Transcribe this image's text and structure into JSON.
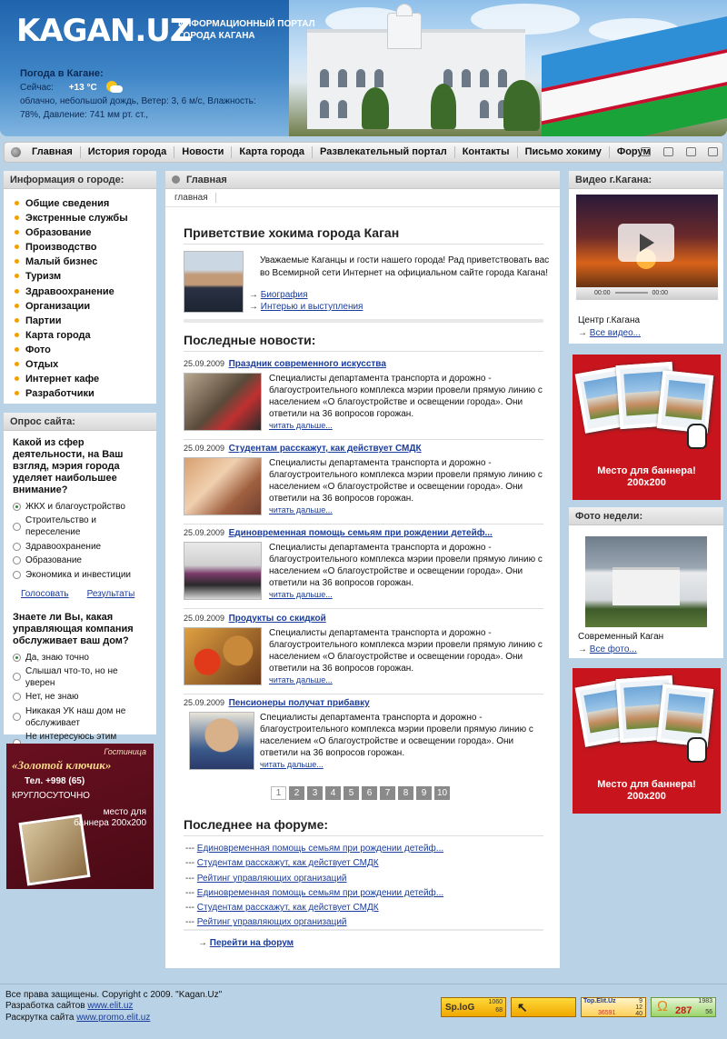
{
  "header": {
    "logo": "KAGAN.UZ",
    "slogan_line1": "ИНФОРМАЦИОННЫЙ ПОРТАЛ",
    "slogan_line2": "ГОРОДА КАГАНА",
    "weather_title": "Погода в Кагане:",
    "weather_now_label": "Сейчас:",
    "weather_temp": "+13 °C",
    "weather_desc": "облачно, небольшой дождь, Ветер: 3, 6 м/с, Влажность: 78%, Давление: 741 мм рт. ст.,"
  },
  "nav": {
    "items": [
      "Главная",
      "История города",
      "Новости",
      "Карта города",
      "Развлекательный портал",
      "Контакты",
      "Письмо хокиму",
      "Форум"
    ],
    "icons": [
      "home-icon",
      "folder-icon",
      "print-icon",
      "mail-icon"
    ]
  },
  "info": {
    "title": "Информация о городе:",
    "items": [
      "Общие сведения",
      "Экстренные службы",
      "Образование",
      "Производство",
      "Малый бизнес",
      "Туризм",
      "Здравоохранение",
      "Организации",
      "Партии",
      "Карта города",
      "Фото",
      "Отдых",
      "Интернет кафе",
      "Разработчики"
    ]
  },
  "poll": {
    "title": "Опрос сайта:",
    "q1": "Какой из сфер деятельности, на Ваш взгляд, мэрия города уделяет наибольшее внимание?",
    "q1_options": [
      "ЖКХ и благоустройство",
      "Строительство и переселение",
      "Здравоохранение",
      "Образование",
      "Экономика и инвестиции"
    ],
    "q1_selected": 0,
    "vote": "Голосовать",
    "results": "Результаты",
    "q2": "Знаете ли Вы, какая управляющая компания обслуживает ваш дом?",
    "q2_options": [
      "Да, знаю точно",
      "Слышал что-то, но не уверен",
      "Нет, не знаю",
      "Никакая УК наш дом не обслуживает",
      "Не интересуюсь этим вопросом"
    ],
    "q2_selected": 0
  },
  "hotel_ad": {
    "line1": "Гостиница",
    "name": "«Золотой ключик»",
    "phone": "Тел.  +998 (65)",
    "hours": "КРУГЛОСУТОЧНО",
    "banner": "место для баннера 200x200"
  },
  "main": {
    "header": "Главная",
    "breadcrumb": "главная",
    "greeting_title": "Приветствие хокима города Каган",
    "greeting_text": "Уважаемые Каганцы и гости нашего города! Рад приветствовать вас во Всемирной сети Интернет на официальном сайте города Кагана!",
    "bio_link": "Биография",
    "speech_link": "Интерью и выступления",
    "news_title": "Последные новости:",
    "news": [
      {
        "date": "25.09.2009",
        "title": "Праздник современного искусства",
        "text": "Специалисты департамента транспорта и дорожно - благоустроительного комплекса мэрии провели прямую линию с населением «О благоустройстве и освещении города». Они ответили на 36 вопросов горожан.",
        "more": "читать дальше..."
      },
      {
        "date": "25.09.2009",
        "title": "Студентам расскажут, как действует СМДК",
        "text": "Специалисты департамента транспорта и дорожно - благоустроительного комплекса мэрии провели прямую линию с населением «О благоустройстве и освещении города». Они ответили на 36 вопросов горожан.",
        "more": "читать дальше..."
      },
      {
        "date": "25.09.2009",
        "title": "Единовременная помощь семьям при рождении детейф...",
        "text": "Специалисты департамента транспорта и дорожно - благоустроительного комплекса мэрии провели прямую линию с населением «О благоустройстве и освещении города». Они ответили на 36 вопросов горожан.",
        "more": "читать дальше..."
      },
      {
        "date": "25.09.2009",
        "title": "Продукты со скидкой",
        "text": "Специалисты департамента транспорта и дорожно - благоустроительного комплекса мэрии провели прямую линию с населением «О благоустройстве и освещении города». Они ответили на 36 вопросов горожан.",
        "more": "читать дальше..."
      },
      {
        "date": "25.09.2009",
        "title": "Пенсионеры получат прибавку",
        "text": "Специалисты департамента транспорта и дорожно - благоустроительного комплекса мэрии провели прямую линию с населением «О благоустройстве и освещении города». Они ответили на 36 вопросов горожан.",
        "more": "читать дальше..."
      }
    ],
    "pages": [
      "1",
      "2",
      "3",
      "4",
      "5",
      "6",
      "7",
      "8",
      "9",
      "10"
    ],
    "current_page": "1",
    "forum_title": "Последнее на форуме:",
    "forum_links": [
      "Единовременная помощь семьям при рождении детейф...",
      "Студентам расскажут, как действует СМДК",
      "Рейтинг управляющих организаций",
      "Единовременная помощь семьям при рождении детейф...",
      "Студентам расскажут, как действует СМДК",
      "Рейтинг управляющих организаций"
    ],
    "forum_go": "Перейти на форум"
  },
  "right": {
    "video_title": "Видео г.Кагана:",
    "video_time": "00:00",
    "video_time_end": "00:00",
    "video_caption": "Центр г.Кагана",
    "all_videos": "Все видео...",
    "banner_text_1": "Место для баннера!",
    "banner_text_2": "200x200",
    "photo_title": "Фото недели:",
    "photo_caption": "Современный Каган",
    "all_photos": "Все фото..."
  },
  "footer": {
    "copyright": "Все права защищены. Copyright c 2009. \"Kagan.Uz\"",
    "dev_label": "Разработка сайтов",
    "dev_link": "www.elit.uz",
    "promo_label": "Раскрутка сайта",
    "promo_link": "www.promo.elit.uz",
    "counter1_brand": "Sp.loG",
    "counter1_a": "1060",
    "counter1_b": "68",
    "counter3_brand": "Top.Elit.Uz",
    "counter3_a": "9",
    "counter3_b": "12",
    "counter3_c": "36591",
    "counter3_d": "40",
    "counter4_a": "1983",
    "counter4_b": "287",
    "counter4_c": "56"
  }
}
